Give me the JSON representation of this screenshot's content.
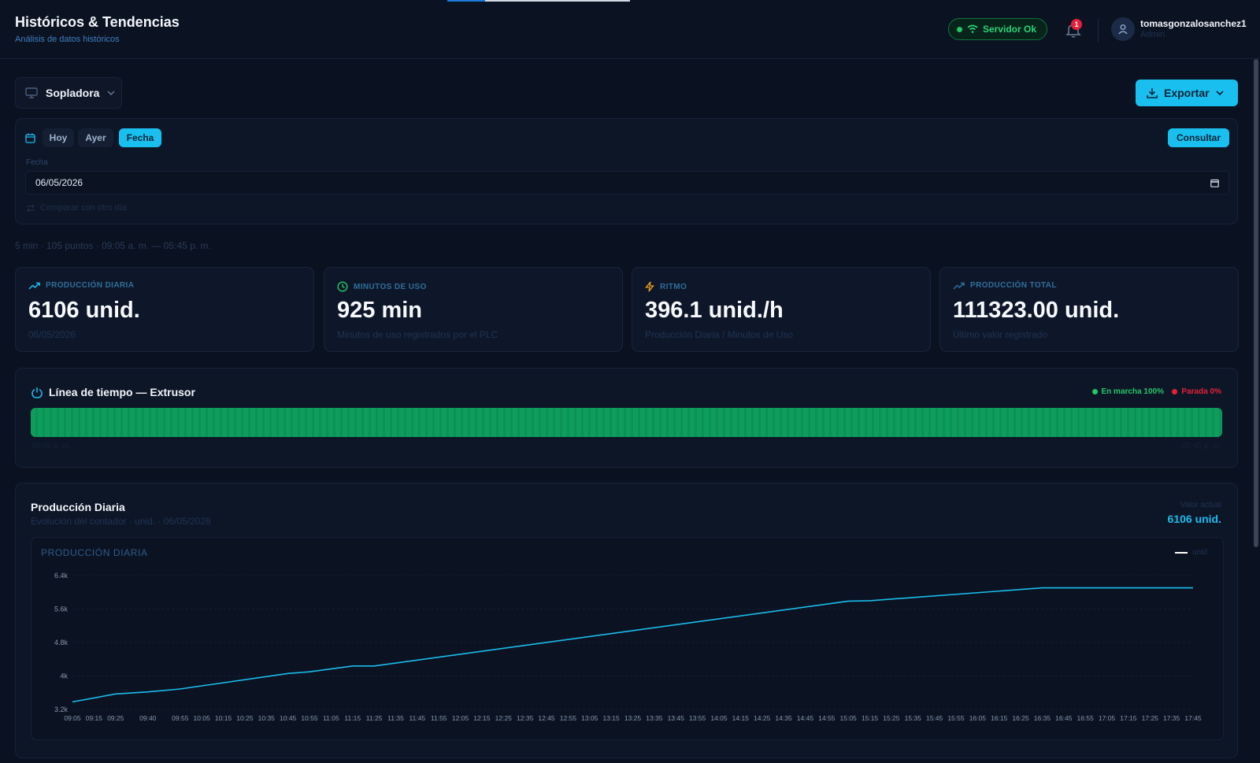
{
  "header": {
    "title": "Históricos & Tendencias",
    "subtitle": "Análisis de datos históricos",
    "server_status": "Servidor Ok",
    "notifications": "1",
    "user_name": "tomasgonzalosanchez1",
    "user_role": "Admin"
  },
  "toolbar": {
    "machine": "Sopladora",
    "export_label": "Exportar"
  },
  "filter": {
    "quick": [
      "Hoy",
      "Ayer",
      "Fecha"
    ],
    "active_quick": "Fecha",
    "consult_label": "Consultar",
    "date_label": "Fecha",
    "date_value": "06/05/2026",
    "compare_label": "Comparar con otro día"
  },
  "summary": {
    "interval": "5 min · 105 puntos ·",
    "range": "09:05 a. m. — 05:45 p. m."
  },
  "kpis": [
    {
      "label": "PRODUCCIÓN DIARIA",
      "value": "6106 unid.",
      "sub": "06/05/2026",
      "color": "#1bbcee",
      "icon": "trending-up-icon"
    },
    {
      "label": "MINUTOS DE USO",
      "value": "925 min",
      "sub": "Minutos de uso registrados por el PLC",
      "color": "#22c766",
      "icon": "clock-icon"
    },
    {
      "label": "RITMO",
      "value": "396.1 unid./h",
      "sub": "Producción Diaria / Minutos de Uso",
      "color": "#f0a020",
      "icon": "bolt-icon"
    },
    {
      "label": "PRODUCCIÓN TOTAL",
      "value": "111323.00 unid.",
      "sub": "Último valor registrado",
      "color": "#1bbcee",
      "icon": "trending-up-icon"
    }
  ],
  "timeline": {
    "title": "Línea de tiempo — Extrusor",
    "running_label": "En marcha 100%",
    "stopped_label": "Parada 0%",
    "running_color": "#22c766",
    "stopped_color": "#e5203a",
    "running_fraction": 1.0,
    "start_time": "09:05 a. m.",
    "end_time": "05:45 p. m."
  },
  "production": {
    "title": "Producción Diaria",
    "subtitle": "Evolución del contador · unid. · 06/05/2026",
    "current_label": "Valor actual",
    "current_value": "6106 unid.",
    "chart_title": "PRODUCCIÓN DIARIA",
    "legend_label": "unid"
  },
  "chart_data": {
    "type": "line",
    "title": "PRODUCCIÓN DIARIA",
    "xlabel": "",
    "ylabel": "",
    "ylim": [
      3200,
      6400
    ],
    "y_ticks": [
      3200,
      4000,
      4800,
      5600,
      6400
    ],
    "y_tick_labels": [
      "3.2k",
      "4k",
      "4.8k",
      "5.6k",
      "6.4k"
    ],
    "x_tick_labels": [
      "09:05",
      "09:15",
      "09:25",
      "09:40",
      "09:55",
      "10:05",
      "10:15",
      "10:25",
      "10:35",
      "10:45",
      "10:55",
      "11:05",
      "11:15",
      "11:25",
      "11:35",
      "11:45",
      "11:55",
      "12:05",
      "12:15",
      "12:25",
      "12:35",
      "12:45",
      "12:55",
      "13:05",
      "13:15",
      "13:25",
      "13:35",
      "13:45",
      "13:55",
      "14:05",
      "14:15",
      "14:25",
      "14:35",
      "14:45",
      "14:55",
      "15:05",
      "15:15",
      "15:25",
      "15:35",
      "15:45",
      "15:55",
      "16:05",
      "16:15",
      "16:25",
      "16:35",
      "16:45",
      "16:55",
      "17:05",
      "17:15",
      "17:25",
      "17:35",
      "17:45"
    ],
    "series": [
      {
        "name": "unid",
        "color": "#1bbcee",
        "x": [
          "09:05",
          "09:25",
          "09:40",
          "09:55",
          "10:45",
          "10:55",
          "11:15",
          "11:25",
          "15:05",
          "15:15",
          "16:35",
          "17:45"
        ],
        "values": [
          3380,
          3570,
          3620,
          3690,
          4060,
          4100,
          4240,
          4240,
          5790,
          5800,
          6106,
          6106
        ]
      }
    ],
    "grid": true,
    "legend": "top-right"
  }
}
